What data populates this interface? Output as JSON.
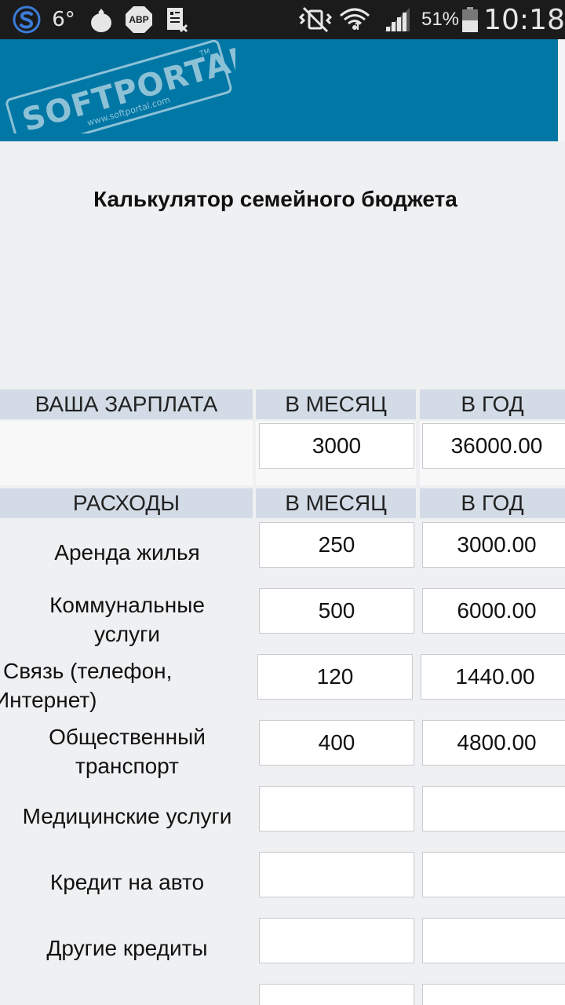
{
  "status_bar": {
    "temperature": "6°",
    "abp_label": "ABP",
    "battery_percent": "51%",
    "time": "10:18"
  },
  "watermark": {
    "brand": "SOFTPORTAL",
    "url": "www.softportal.com",
    "tm": "TM"
  },
  "page": {
    "title": "Калькулятор семейного бюджета"
  },
  "salary": {
    "header_label": "ВАША ЗАРПЛАТА",
    "header_month": "В МЕСЯЦ",
    "header_year": "В ГОД",
    "month_value": "3000",
    "year_value": "36000.00"
  },
  "expenses": {
    "header_label": "РАСХОДЫ",
    "header_month": "В МЕСЯЦ",
    "header_year": "В ГОД",
    "rows": [
      {
        "label_line1": "Аренда жилья",
        "label_line2": "",
        "month": "250",
        "year": "3000.00"
      },
      {
        "label_line1": "Коммунальные",
        "label_line2": "услуги",
        "month": "500",
        "year": "6000.00"
      },
      {
        "label_line1": "Связь (телефон,",
        "label_line2": "Интернет)",
        "month": "120",
        "year": "1440.00"
      },
      {
        "label_line1": "Общественный",
        "label_line2": "транспорт",
        "month": "400",
        "year": "4800.00"
      },
      {
        "label_line1": "Медицинские услуги",
        "label_line2": "",
        "month": "",
        "year": ""
      },
      {
        "label_line1": "Кредит на авто",
        "label_line2": "",
        "month": "",
        "year": ""
      },
      {
        "label_line1": "Другие кредиты",
        "label_line2": "",
        "month": "",
        "year": ""
      },
      {
        "label_line1": "",
        "label_line2": "",
        "month": "",
        "year": ""
      }
    ]
  },
  "colors": {
    "banner": "#0077a5",
    "header_bg": "#d3dce6",
    "page_bg": "#eff0f2"
  }
}
